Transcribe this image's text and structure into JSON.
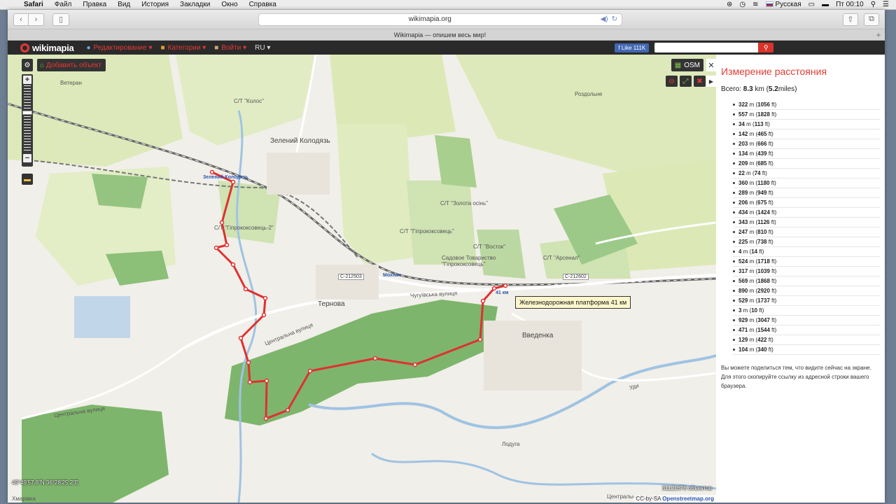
{
  "menubar": {
    "apple_icon": "apple-icon",
    "app": "Safari",
    "items": [
      "Файл",
      "Правка",
      "Вид",
      "История",
      "Закладки",
      "Окно",
      "Справка"
    ],
    "input_source": "Русская",
    "clock": "Пт 00:10"
  },
  "browser": {
    "url": "wikimapia.org",
    "tab_title": "Wikimapia — опишем весь мир!",
    "plus": "+"
  },
  "wikimapia": {
    "logo": "wikimapia",
    "menu": [
      "Редактирование",
      "Категории",
      "Войти"
    ],
    "lang": "RU",
    "fb_like": "Like 111K",
    "search_placeholder": "",
    "add_object": "Добавить объект",
    "osm_button": "OSM"
  },
  "map": {
    "labels": {
      "zeleniy_kolodyaz": "Зелений Колодязь",
      "zeleniy_kolodyaz_station": "Зелений Колодязь",
      "mokhnach": "Мохнач",
      "ternova": "Тернова",
      "vvedenka": "Введенка",
      "rozdolne": "Роздольне",
      "veteran": "Ветеран",
      "st_kolos": "С/Т \"Колос\"",
      "st_gyprokoksovets": "С/Т \"Гіпрококсовець\"",
      "st_zolota_osin": "С/Т \"Золота осінь\"",
      "st_gyprokoksovets2": "С/Т \"Гіпрококсовець-2\"",
      "st_vostok": "С/Т \"Восток\"",
      "st_arsenal": "С/Т \"Арсенал\"",
      "sad_tovarystvo": "Садовое Товариство \"Гіпрококсовець\"",
      "road_c212503": "С-212503",
      "road_c212602": "С-212602",
      "chuguivska": "Чугуївська вулиця",
      "tsentralna": "Центральна вулиця",
      "tsentralna2": "Центральна вулиця",
      "tsentralna3": "Центральна вулиця",
      "km41": "41 км",
      "khmarivka": "Хмарівка",
      "udy": "Уди",
      "lodyga": "Лодуга"
    },
    "tooltip": "Железнодорожная платформа 41 км",
    "coords": "49°49'57.8\"N 36°28'25.2\"E",
    "objects_count": "31121676 объектов",
    "attribution_prefix": "CC-by-SA",
    "attribution_link": "Openstreetmap.org"
  },
  "measure": {
    "title": "Измерение расстояния",
    "total_label": "Всего:",
    "total_km": "8.3",
    "total_km_unit": "km",
    "total_miles": "5.2",
    "total_miles_unit": "miles",
    "segments": [
      {
        "m": "322",
        "ft": "1056"
      },
      {
        "m": "557",
        "ft": "1828"
      },
      {
        "m": "34",
        "ft": "113"
      },
      {
        "m": "142",
        "ft": "465"
      },
      {
        "m": "203",
        "ft": "666"
      },
      {
        "m": "134",
        "ft": "439"
      },
      {
        "m": "209",
        "ft": "685"
      },
      {
        "m": "22",
        "ft": "74"
      },
      {
        "m": "360",
        "ft": "1180"
      },
      {
        "m": "289",
        "ft": "949"
      },
      {
        "m": "206",
        "ft": "675"
      },
      {
        "m": "434",
        "ft": "1424"
      },
      {
        "m": "343",
        "ft": "1126"
      },
      {
        "m": "247",
        "ft": "810"
      },
      {
        "m": "225",
        "ft": "738"
      },
      {
        "m": "4",
        "ft": "14"
      },
      {
        "m": "524",
        "ft": "1718"
      },
      {
        "m": "317",
        "ft": "1039"
      },
      {
        "m": "569",
        "ft": "1868"
      },
      {
        "m": "890",
        "ft": "2920"
      },
      {
        "m": "529",
        "ft": "1737"
      },
      {
        "m": "3",
        "ft": "10"
      },
      {
        "m": "929",
        "ft": "3047"
      },
      {
        "m": "471",
        "ft": "1544"
      },
      {
        "m": "129",
        "ft": "422"
      },
      {
        "m": "104",
        "ft": "340"
      }
    ],
    "share_text": "Вы можете поделиться тем, что видите сейчас на экране. Для этого скопируйте ссылку из адресной строки вашего браузера."
  },
  "colors": {
    "route": "#e03030",
    "accent_red": "#e53935",
    "forest": "#7cb36a",
    "field": "#dbe8b8",
    "water": "#a9c9e4",
    "header": "#2a2a2a"
  }
}
